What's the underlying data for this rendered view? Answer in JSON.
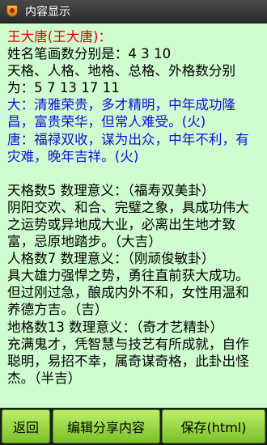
{
  "window": {
    "title": "内容显示"
  },
  "content": {
    "heading": "王大唐(王大唐)：",
    "strokes": "姓名笔画数分别是：4 3 10",
    "grids_label": "天格、人格、地格、总格、外格数分别为：5 7 13 17 11",
    "fortune_da": "大：清雅荣贵，多才精明，中年成功隆昌，富贵荣华，但常人难受。(火)",
    "fortune_tang": "唐：福禄双收，谋为出众，中年不利，有灾难，晚年吉祥。(火)",
    "tiange_title": "天格数5 数理意义：（福寿双美卦）",
    "tiange_text": "阴阳交欢、和合、完璧之象，具成功伟大之运势或异地成大业，必离出生地才致富，忌原地踏步。（大吉）",
    "renge_title": "人格数7 数理意义：（刚顽俊敏卦）",
    "renge_text": "具大雄力强悍之势，勇往直前获大成功。但过刚过急，酿成内外不和，女性用温和养德方吉。（吉）",
    "dige_title": "地格数13 数理意义：（奇才艺精卦）",
    "dige_text": "充满鬼才，凭智慧与技艺有所成就，自作聪明，易招不幸，属奇谋奇格，此卦出怪杰。（半吉）"
  },
  "buttons": {
    "back": "返回",
    "edit_share": "编辑分享内容",
    "save_html": "保存(html)"
  },
  "colors": {
    "content_bg": "#cffccf",
    "heading": "#e00000",
    "fortune": "#1010d8",
    "button": "#8fd43c"
  }
}
